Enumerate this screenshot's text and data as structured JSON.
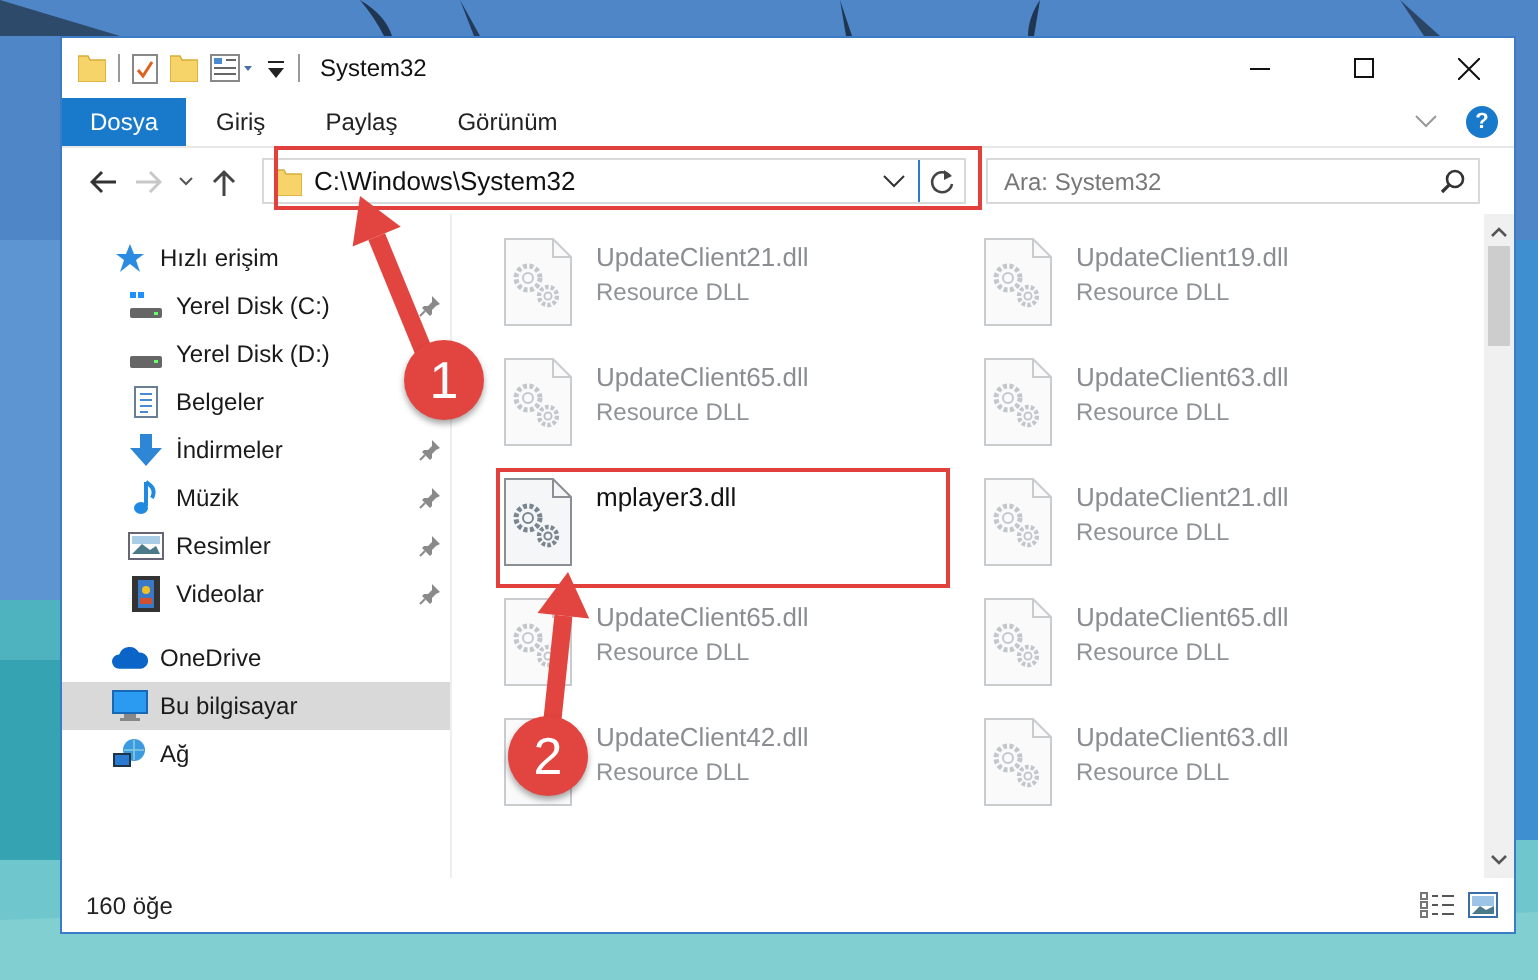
{
  "window": {
    "title": "System32"
  },
  "ribbon_tabs": [
    {
      "label": "Dosya",
      "selected": true
    },
    {
      "label": "Giriş",
      "selected": false
    },
    {
      "label": "Paylaş",
      "selected": false
    },
    {
      "label": "Görünüm",
      "selected": false
    }
  ],
  "help_button": "?",
  "navigation": {
    "back_enabled": true,
    "forward_enabled": false
  },
  "address_bar": {
    "path": "C:\\Windows\\System32"
  },
  "search": {
    "placeholder": "Ara: System32"
  },
  "sidebar": {
    "items": [
      {
        "label": "Hızlı erişim",
        "kind": "star",
        "selected": false,
        "children": [
          {
            "label": "Yerel Disk (C:)",
            "kind": "drive-system",
            "pinned": true,
            "selected": false
          },
          {
            "label": "Yerel Disk (D:)",
            "kind": "drive",
            "pinned": false,
            "selected": false
          },
          {
            "label": "Belgeler",
            "kind": "documents",
            "pinned": false,
            "selected": false
          },
          {
            "label": "İndirmeler",
            "kind": "download",
            "pinned": true,
            "selected": false
          },
          {
            "label": "Müzik",
            "kind": "music",
            "pinned": true,
            "selected": false
          },
          {
            "label": "Resimler",
            "kind": "pictures",
            "pinned": true,
            "selected": false
          },
          {
            "label": "Videolar",
            "kind": "videos",
            "pinned": true,
            "selected": false
          }
        ]
      },
      {
        "label": "OneDrive",
        "kind": "cloud",
        "selected": false
      },
      {
        "label": "Bu bilgisayar",
        "kind": "computer",
        "selected": true
      },
      {
        "label": "Ağ",
        "kind": "network",
        "selected": false
      }
    ]
  },
  "files": [
    {
      "name": "UpdateClient21.dll",
      "type": "Resource DLL",
      "blurred": true
    },
    {
      "name": "UpdateClient19.dll",
      "type": "Resource DLL",
      "blurred": true
    },
    {
      "name": "UpdateClient65.dll",
      "type": "Resource DLL",
      "blurred": true
    },
    {
      "name": "UpdateClient63.dll",
      "type": "Resource DLL",
      "blurred": true
    },
    {
      "name": "mplayer3.dll",
      "blurred": false
    },
    {
      "name": "UpdateClient21.dll",
      "type": "Resource DLL",
      "blurred": true
    },
    {
      "name": "UpdateClient65.dll",
      "type": "Resource DLL",
      "blurred": true
    },
    {
      "name": "UpdateClient65.dll",
      "type": "Resource DLL",
      "blurred": true
    },
    {
      "name": "UpdateClient42.dll",
      "type": "Resource DLL",
      "blurred": true
    },
    {
      "name": "UpdateClient63.dll",
      "type": "Resource DLL",
      "blurred": true
    }
  ],
  "status_bar": {
    "item_count": "160 öğe"
  },
  "callouts": [
    {
      "number": "1"
    },
    {
      "number": "2"
    }
  ]
}
